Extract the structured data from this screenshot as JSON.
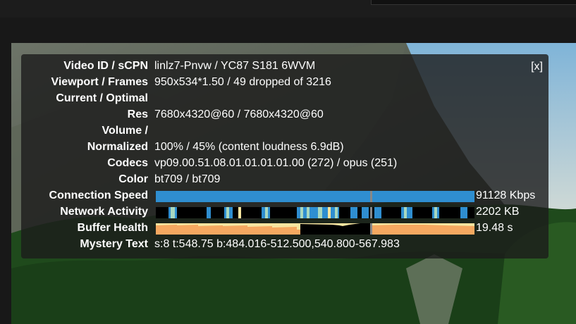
{
  "close_label": "[x]",
  "rows": [
    {
      "label": "Video ID / sCPN",
      "value": "linlz7-Pnvw / YC87 S181 6WVM"
    },
    {
      "label": "Viewport / Frames",
      "value": "950x534*1.50 / 49 dropped of 3216"
    },
    {
      "label": "Current / Optimal",
      "value": ""
    },
    {
      "label": "Res",
      "value": "7680x4320@60 / 7680x4320@60"
    },
    {
      "label": "Volume /",
      "value": ""
    },
    {
      "label": "Normalized",
      "value": "100% / 45% (content loudness 6.9dB)"
    },
    {
      "label": "Codecs",
      "value": "vp09.00.51.08.01.01.01.01.00 (272) / opus (251)"
    },
    {
      "label": "Color",
      "value": "bt709 / bt709"
    }
  ],
  "graphs": {
    "connection_speed": {
      "label": "Connection Speed",
      "value": "91128 Kbps"
    },
    "network_activity": {
      "label": "Network Activity",
      "value": "2202 KB"
    },
    "buffer_health": {
      "label": "Buffer Health",
      "value": "19.48 s"
    }
  },
  "mystery": {
    "label": "Mystery Text",
    "value": "s:8 t:548.75 b:484.016-512.500,540.800-567.983"
  },
  "colors": {
    "speed_bar": "#2f8ed0",
    "activity_dark": "#000000",
    "activity_blue": "#2f8ed0",
    "activity_light": "#a8d8c0",
    "buffer_orange": "#f5a860",
    "buffer_light": "#f8e5a0"
  }
}
